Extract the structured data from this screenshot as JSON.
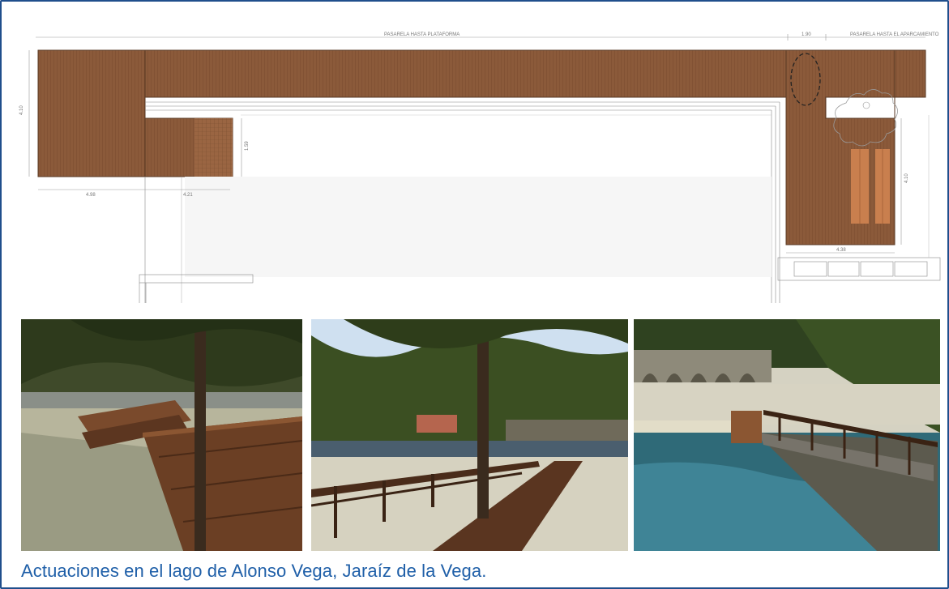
{
  "plan": {
    "label_top_main": "PASARELA HASTA PLATAFORMA",
    "label_top_right": "PASARELA HASTA EL APARCAMIENTO",
    "dim_top_right": "1.90",
    "dim_left_height": "4.10",
    "dim_bottom_left": "4.98",
    "dim_bottom_mid": "4.21",
    "dim_mid_height": "1.59",
    "dim_right_height": "4.10",
    "dim_right_bottom": "4.38"
  },
  "photos": [
    {
      "subject": "wooden-benches-under-tree"
    },
    {
      "subject": "wooden-boardwalk-with-railing-by-tree"
    },
    {
      "subject": "boardwalk-along-lake-with-stone-bridge"
    }
  ],
  "caption": "Actuaciones en el lago de Alonso Vega, Jaraíz de la Vega.",
  "colors": {
    "border": "#1f4e8c",
    "caption": "#1f5fa8",
    "wood": "#8a5a3a"
  }
}
